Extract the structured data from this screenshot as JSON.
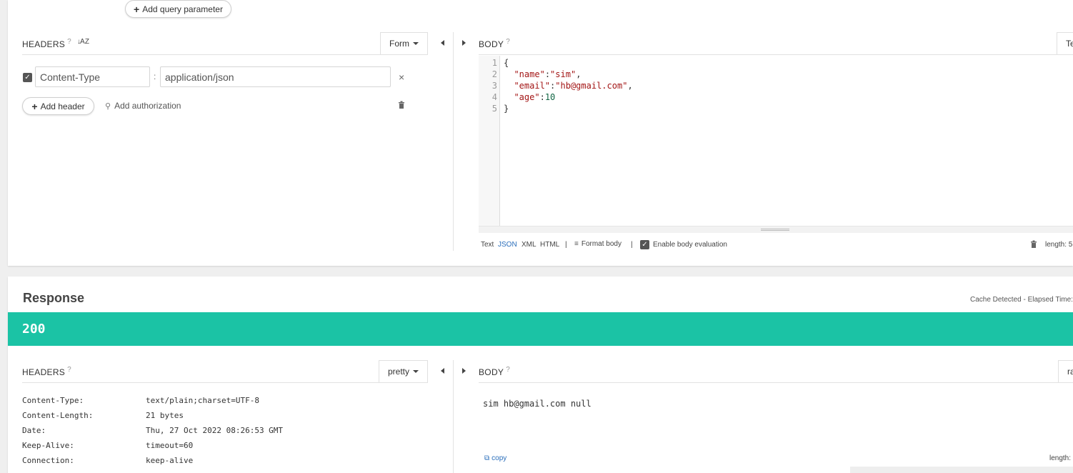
{
  "request": {
    "add_query_param_label": "Add query parameter",
    "headers": {
      "title": "HEADERS",
      "help": "?",
      "sort_icon_text": "↓A Z",
      "mode": "Form",
      "rows": [
        {
          "enabled": true,
          "name": "Content-Type",
          "separator": ":",
          "value": "application/json"
        }
      ],
      "add_header_label": "Add header",
      "add_auth_label": "Add authorization"
    },
    "body": {
      "title": "BODY",
      "help": "?",
      "mode_partial": "Te",
      "line_numbers": [
        "1",
        "2",
        "3",
        "4",
        "5"
      ],
      "json": {
        "name": "sim",
        "email": "hb@gmail.com",
        "age": "10"
      },
      "toolbar": {
        "text": "Text",
        "json": "JSON",
        "xml": "XML",
        "html": "HTML",
        "sep": "|",
        "format_body": "Format body",
        "enable_eval": "Enable body evaluation",
        "length": "length: 5"
      }
    }
  },
  "response": {
    "title": "Response",
    "cache_info": "Cache Detected - Elapsed Time:",
    "status": "200",
    "status_color": "#1bc3a5",
    "headers": {
      "title": "HEADERS",
      "help": "?",
      "mode": "pretty",
      "rows": [
        {
          "key": "Content-Type:",
          "value": "text/plain;charset=UTF-8"
        },
        {
          "key": "Content-Length:",
          "value": "21 bytes"
        },
        {
          "key": "Date:",
          "value": "Thu, 27 Oct 2022 08:26:53 GMT"
        },
        {
          "key": "Keep-Alive:",
          "value": "timeout=60"
        },
        {
          "key": "Connection:",
          "value": "keep-alive"
        }
      ]
    },
    "body": {
      "title": "BODY",
      "help": "?",
      "mode_partial": "ra",
      "content": "sim hb@gmail.com null",
      "copy_label": "copy",
      "length_label": "length:"
    }
  }
}
